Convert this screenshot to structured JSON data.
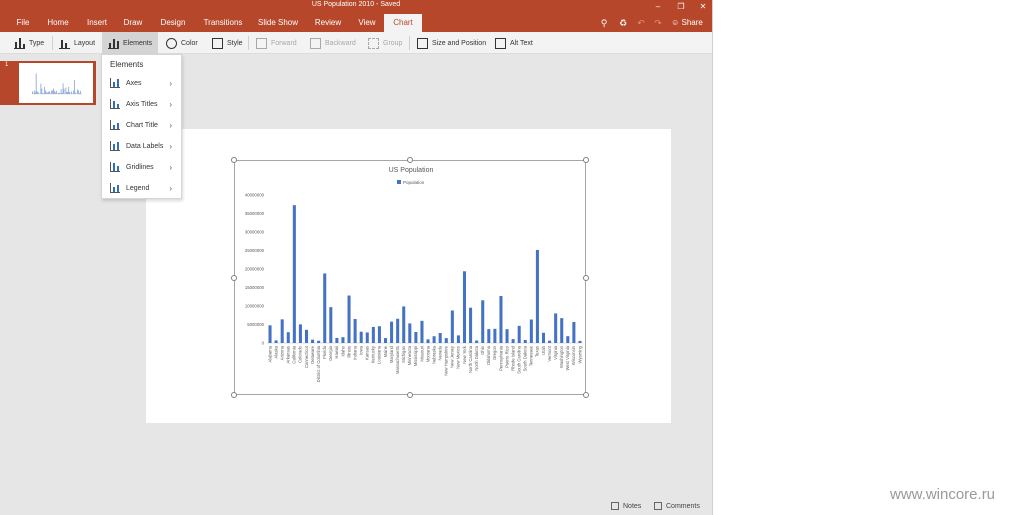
{
  "window": {
    "title": "US Population 2010 - Saved"
  },
  "tabs": [
    {
      "id": "file",
      "label": "File"
    },
    {
      "id": "home",
      "label": "Home"
    },
    {
      "id": "insert",
      "label": "Insert"
    },
    {
      "id": "draw",
      "label": "Draw"
    },
    {
      "id": "design",
      "label": "Design"
    },
    {
      "id": "transitions",
      "label": "Transitions"
    },
    {
      "id": "slideshow",
      "label": "Slide Show"
    },
    {
      "id": "review",
      "label": "Review"
    },
    {
      "id": "view",
      "label": "View"
    },
    {
      "id": "chart",
      "label": "Chart",
      "active": true
    }
  ],
  "share_label": "Share",
  "ribbon": {
    "type": "Type",
    "layout": "Layout",
    "elements": "Elements",
    "color": "Color",
    "style": "Style",
    "forward": "Forward",
    "backward": "Backward",
    "group": "Group",
    "size_position": "Size and Position",
    "alt_text": "Alt Text"
  },
  "elements_menu": {
    "header": "Elements",
    "items": [
      {
        "label": "Axes"
      },
      {
        "label": "Axis Titles"
      },
      {
        "label": "Chart Title"
      },
      {
        "label": "Data Labels"
      },
      {
        "label": "Gridlines"
      },
      {
        "label": "Legend"
      }
    ]
  },
  "slide_thumb": {
    "number": "1"
  },
  "status": {
    "notes": "Notes",
    "comments": "Comments"
  },
  "watermark": "www.wincore.ru",
  "colors": {
    "accent": "#b7472a",
    "series": "#4472c4"
  },
  "chart_data": {
    "type": "bar",
    "title": "US Population",
    "legend": "top",
    "series": [
      {
        "name": "Population",
        "values": [
          4780000,
          710000,
          6390000,
          2920000,
          37250000,
          5030000,
          3570000,
          900000,
          600000,
          18800000,
          9690000,
          1360000,
          1570000,
          12830000,
          6480000,
          3050000,
          2850000,
          4340000,
          4530000,
          1330000,
          5770000,
          6550000,
          9880000,
          5300000,
          2970000,
          5990000,
          990000,
          1830000,
          2700000,
          1320000,
          8790000,
          2060000,
          19380000,
          9540000,
          670000,
          11540000,
          3750000,
          3830000,
          12700000,
          3730000,
          1050000,
          4630000,
          810000,
          6350000,
          25150000,
          2760000,
          630000,
          8000000,
          6720000,
          1850000,
          5690000,
          560000
        ]
      }
    ],
    "categories": [
      "Alabama",
      "Alaska",
      "Arizona",
      "Arkansas",
      "California",
      "Colorado",
      "Connecticut",
      "Delaware",
      "District of Columbia",
      "Florida",
      "Georgia",
      "Hawaii",
      "Idaho",
      "Illinois",
      "Indiana",
      "Iowa",
      "Kansas",
      "Kentucky",
      "Louisiana",
      "Maine",
      "Maryland",
      "Massachusetts",
      "Michigan",
      "Minnesota",
      "Mississippi",
      "Missouri",
      "Montana",
      "Nebraska",
      "Nevada",
      "New Hampshire",
      "New Jersey",
      "New Mexico",
      "New York",
      "North Carolina",
      "North Dakota",
      "Ohio",
      "Oklahoma",
      "Oregon",
      "Pennsylvania",
      "Puerto Rico",
      "Rhode Island",
      "South Carolina",
      "South Dakota",
      "Tennessee",
      "Texas",
      "Utah",
      "Vermont",
      "Virginia",
      "Washington",
      "West Virginia",
      "Wisconsin",
      "Wyoming"
    ],
    "yticks": [
      "0",
      "5000000",
      "10000000",
      "15000000",
      "20000000",
      "25000000",
      "30000000",
      "35000000",
      "40000000"
    ],
    "ylim": [
      0,
      40000000
    ],
    "grid": false
  }
}
